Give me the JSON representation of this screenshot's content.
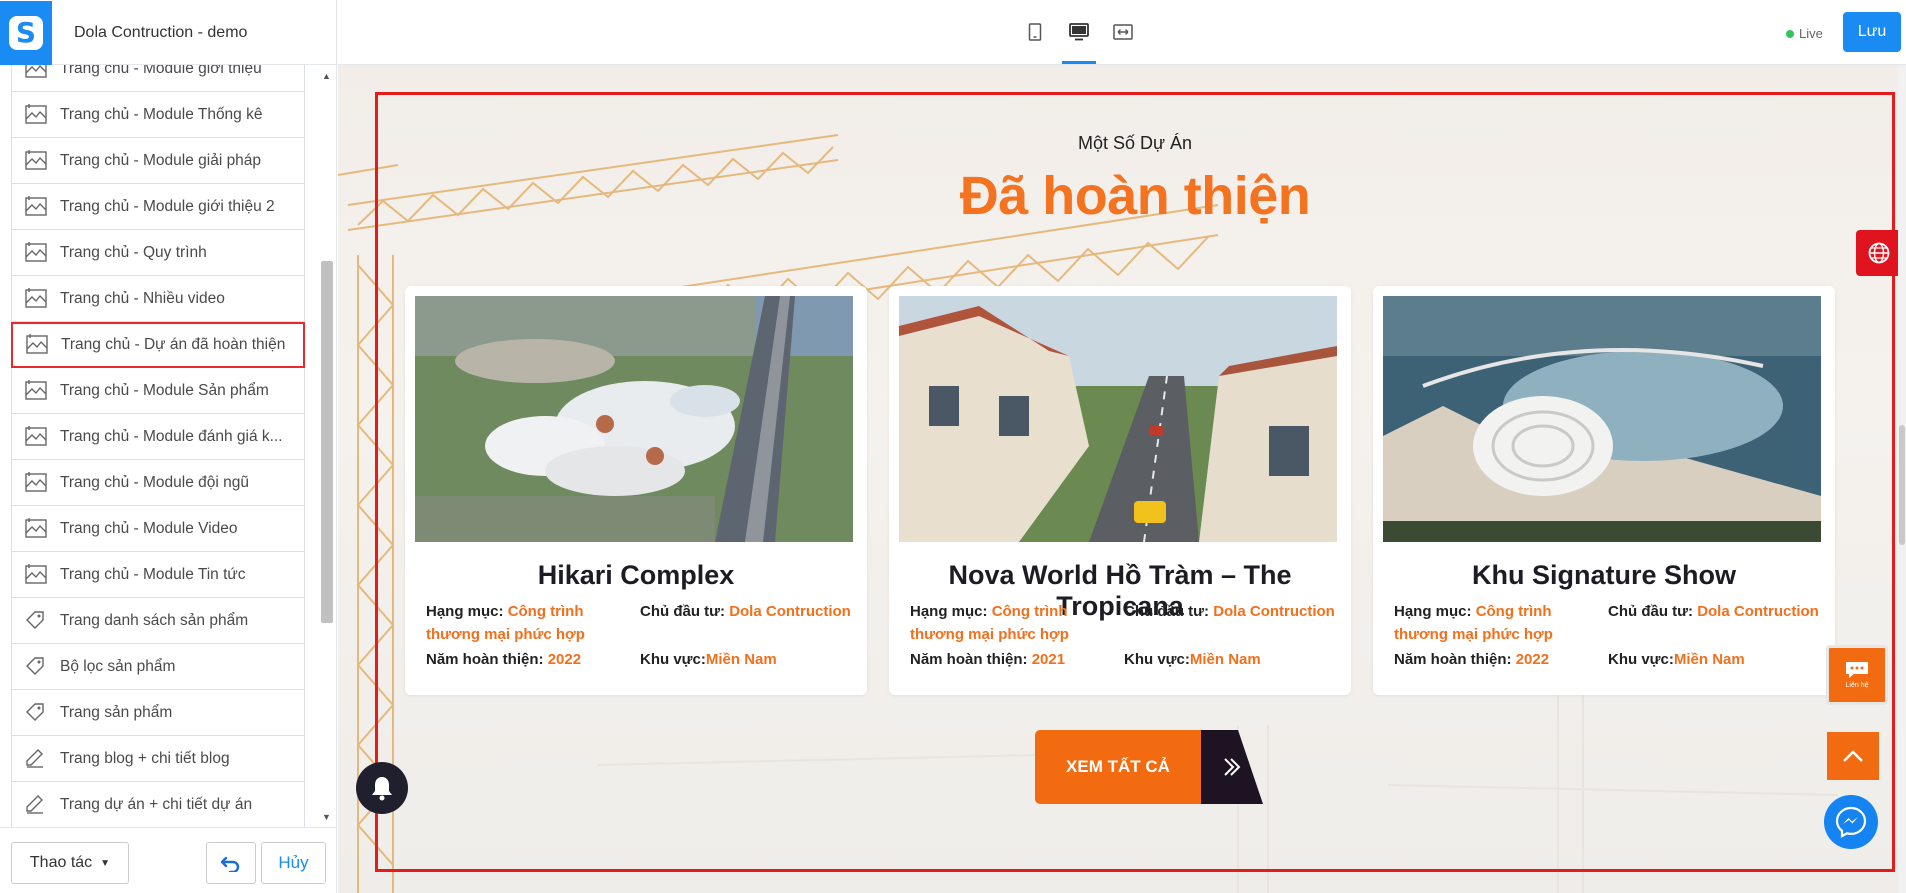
{
  "header": {
    "site_name": "Dola Contruction - demo",
    "live_label": "Live",
    "save_label": "Lưu",
    "devices": [
      "mobile",
      "desktop",
      "fullwidth"
    ],
    "active_device": "desktop"
  },
  "sidebar": {
    "items": [
      {
        "label": "Trang chủ - Module giới thiệu",
        "icon": "layout-icon"
      },
      {
        "label": "Trang chủ - Module Thống kê",
        "icon": "layout-icon"
      },
      {
        "label": "Trang chủ - Module giải pháp",
        "icon": "layout-icon"
      },
      {
        "label": "Trang chủ - Module giới thiệu 2",
        "icon": "layout-icon"
      },
      {
        "label": "Trang chủ - Quy trình",
        "icon": "layout-icon"
      },
      {
        "label": "Trang chủ - Nhiều video",
        "icon": "layout-icon"
      },
      {
        "label": "Trang chủ - Dự án đã hoàn thiện",
        "icon": "layout-icon",
        "selected": true
      },
      {
        "label": "Trang chủ - Module Sản phẩm",
        "icon": "layout-icon"
      },
      {
        "label": "Trang chủ - Module đánh giá k...",
        "icon": "layout-icon"
      },
      {
        "label": "Trang chủ - Module đội ngũ",
        "icon": "layout-icon"
      },
      {
        "label": "Trang chủ - Module Video",
        "icon": "layout-icon"
      },
      {
        "label": "Trang chủ - Module Tin tức",
        "icon": "layout-icon"
      },
      {
        "label": "Trang danh sách sản phẩm",
        "icon": "tag-icon"
      },
      {
        "label": "Bộ lọc sản phẩm",
        "icon": "tag-icon"
      },
      {
        "label": "Trang sản phẩm",
        "icon": "tag-icon"
      },
      {
        "label": "Trang blog + chi tiết blog",
        "icon": "blog-icon"
      },
      {
        "label": "Trang dự án + chi tiết dự án",
        "icon": "blog-icon"
      }
    ],
    "actions_label": "Thao tác",
    "cancel_label": "Hủy"
  },
  "preview": {
    "eyebrow": "Một Số Dự Án",
    "headline": "Đã hoàn thiện",
    "cta_label": "XEM TẤT CẢ",
    "contact_label": "Liên hệ",
    "labels": {
      "category": "Hạng mục:",
      "investor": "Chủ đầu tư:",
      "year": "Năm hoàn thiện:",
      "area": "Khu vực:"
    },
    "projects": [
      {
        "title": "Hikari Complex",
        "category": "Công trình thương mại phức hợp",
        "investor": "Dola Contruction",
        "year": "2022",
        "area": "Miền Nam"
      },
      {
        "title": "Nova World Hồ Tràm – The Tropicana",
        "category": "Công trình thương mại phức hợp",
        "investor": "Dola Contruction",
        "year": "2021",
        "area": "Miền Nam"
      },
      {
        "title": "Khu Signature Show",
        "category": "Công trình thương mại phức hợp",
        "investor": "Dola Contruction",
        "year": "2022",
        "area": "Miền Nam"
      }
    ]
  },
  "colors": {
    "accent_blue": "#1a8bf2",
    "accent_orange": "#f47321",
    "selection_red": "#e51c1c"
  }
}
